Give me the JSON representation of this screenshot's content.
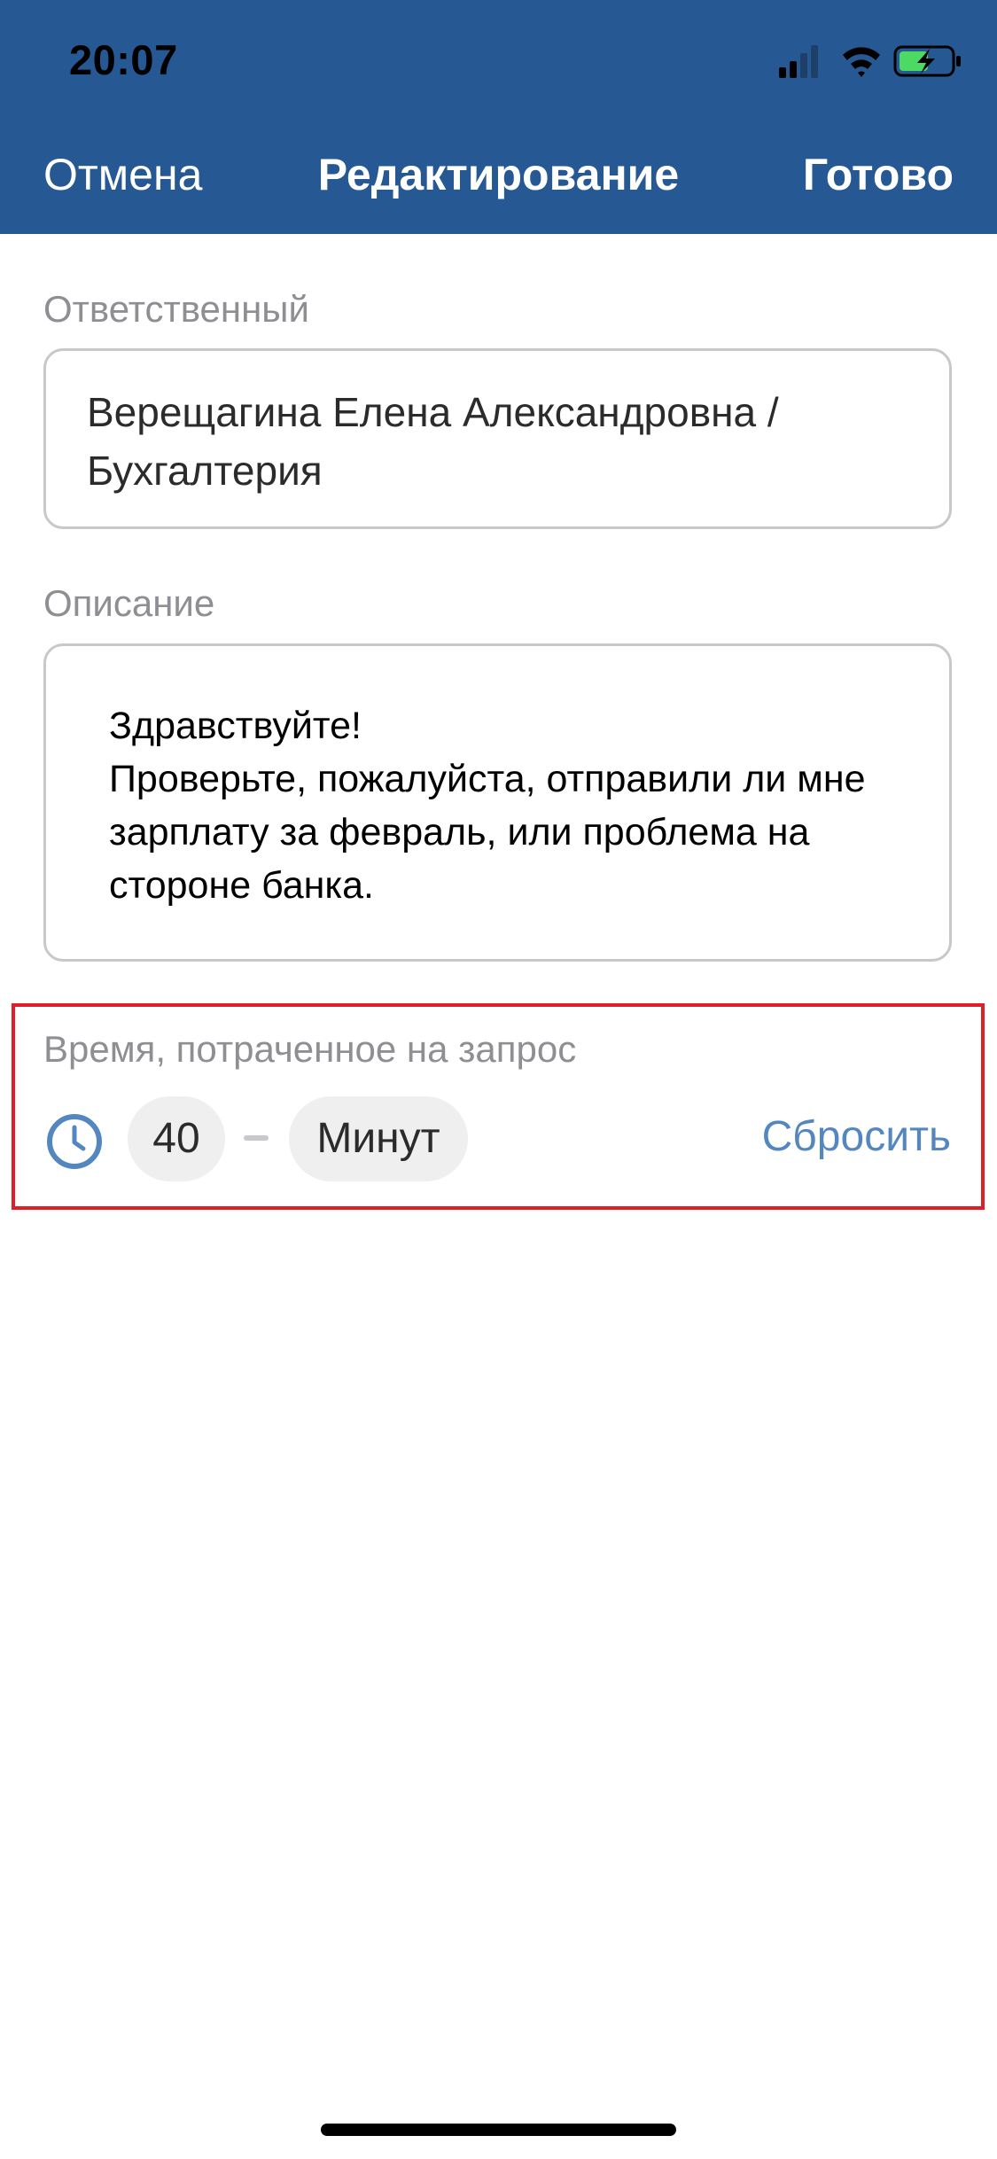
{
  "status_bar": {
    "time": "20:07",
    "icons": [
      "cellular-signal-icon",
      "wifi-icon",
      "battery-charging-icon"
    ],
    "battery_color": "#4cd964"
  },
  "nav": {
    "cancel_label": "Отмена",
    "title": "Редактирование",
    "done_label": "Готово",
    "background": "#265893"
  },
  "assignee": {
    "label": "Ответственный",
    "value": "Верещагина Елена Александровна / Бухгалтерия"
  },
  "description": {
    "label": "Описание",
    "value": "Здравствуйте!\nПроверьте, пожалуйста, отправили ли мне зарплату за февраль, или проблема на стороне банка."
  },
  "time_spent": {
    "label": "Время, потраченное на запрос",
    "icon": "clock-icon",
    "value": "40",
    "unit": "Минут",
    "reset_label": "Сбросить",
    "accent": "#5487bf",
    "highlight_color": "#e01e2a"
  }
}
